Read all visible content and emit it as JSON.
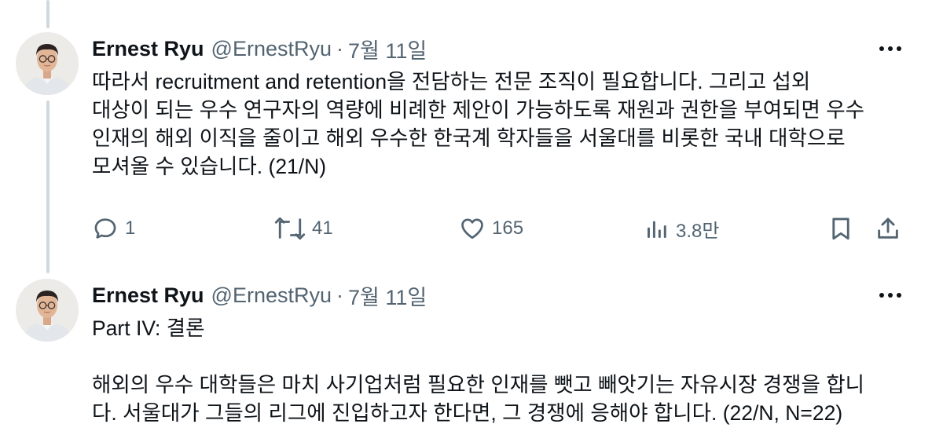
{
  "tweets": [
    {
      "author_name": "Ernest Ryu",
      "handle": "@ErnestRyu",
      "separator": "·",
      "date": "7월 11일",
      "paragraphs": [
        "따라서 recruitment and retention을 전담하는 전문 조직이 필요합니다. 그리고 섭외\n대상이 되는 우수 연구자의 역량에 비례한 제안이 가능하도록 재원과 권한을 부여되면 우수\n인재의 해외 이직을 줄이고 해외 우수한 한국계 학자들을 서울대를 비롯한 국내 대학으로\n모셔올 수 있습니다. (21/N)"
      ],
      "actions": {
        "reply_count": "1",
        "retweet_count": "41",
        "like_count": "165",
        "view_count": "3.8만"
      }
    },
    {
      "author_name": "Ernest Ryu",
      "handle": "@ErnestRyu",
      "separator": "·",
      "date": "7월 11일",
      "paragraphs": [
        "Part IV: 결론",
        "해외의 우수 대학들은 마치 사기업처럼 필요한 인재를 뺏고 빼앗기는 자유시장 경쟁을 합니\n다. 서울대가 그들의 리그에 진입하고자 한다면, 그 경쟁에 응해야 합니다. (22/N, N=22)"
      ]
    }
  ],
  "icons": {
    "reply": "speech-bubble-icon",
    "retweet": "retweet-arrows-icon",
    "like": "heart-icon",
    "views": "bar-chart-icon",
    "bookmark": "bookmark-icon",
    "share": "share-upload-icon",
    "more": "more-dots-icon"
  },
  "colors": {
    "text_primary": "#0f1419",
    "text_secondary": "#536471",
    "thread_line": "#cfd9de",
    "background": "#ffffff"
  }
}
